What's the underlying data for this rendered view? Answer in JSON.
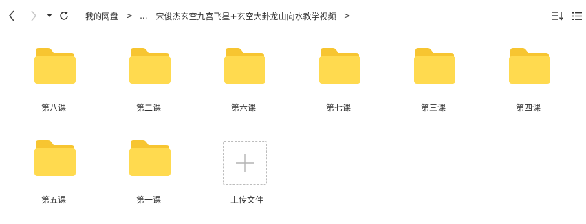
{
  "toolbar": {
    "breadcrumb": [
      "我的网盘",
      "...",
      "宋俊杰玄空九宫飞星+玄空大卦龙山向水教学视频"
    ],
    "breadcrumb_separator": ">",
    "icons": {
      "back": "chevron-left-icon",
      "forward": "chevron-right-icon",
      "history_dropdown": "caret-down-icon",
      "refresh": "refresh-icon",
      "sort": "sort-icon",
      "view": "list-view-icon"
    }
  },
  "folders": [
    {
      "name": "第八课"
    },
    {
      "name": "第二课"
    },
    {
      "name": "第六课"
    },
    {
      "name": "第七课"
    },
    {
      "name": "第三课"
    },
    {
      "name": "第四课"
    },
    {
      "name": "第五课"
    },
    {
      "name": "第一课"
    }
  ],
  "upload": {
    "label": "上传文件",
    "icon": "plus-icon"
  },
  "colors": {
    "folder_back": "#F7C531",
    "folder_front": "#FFDA4F",
    "text": "#333333"
  }
}
